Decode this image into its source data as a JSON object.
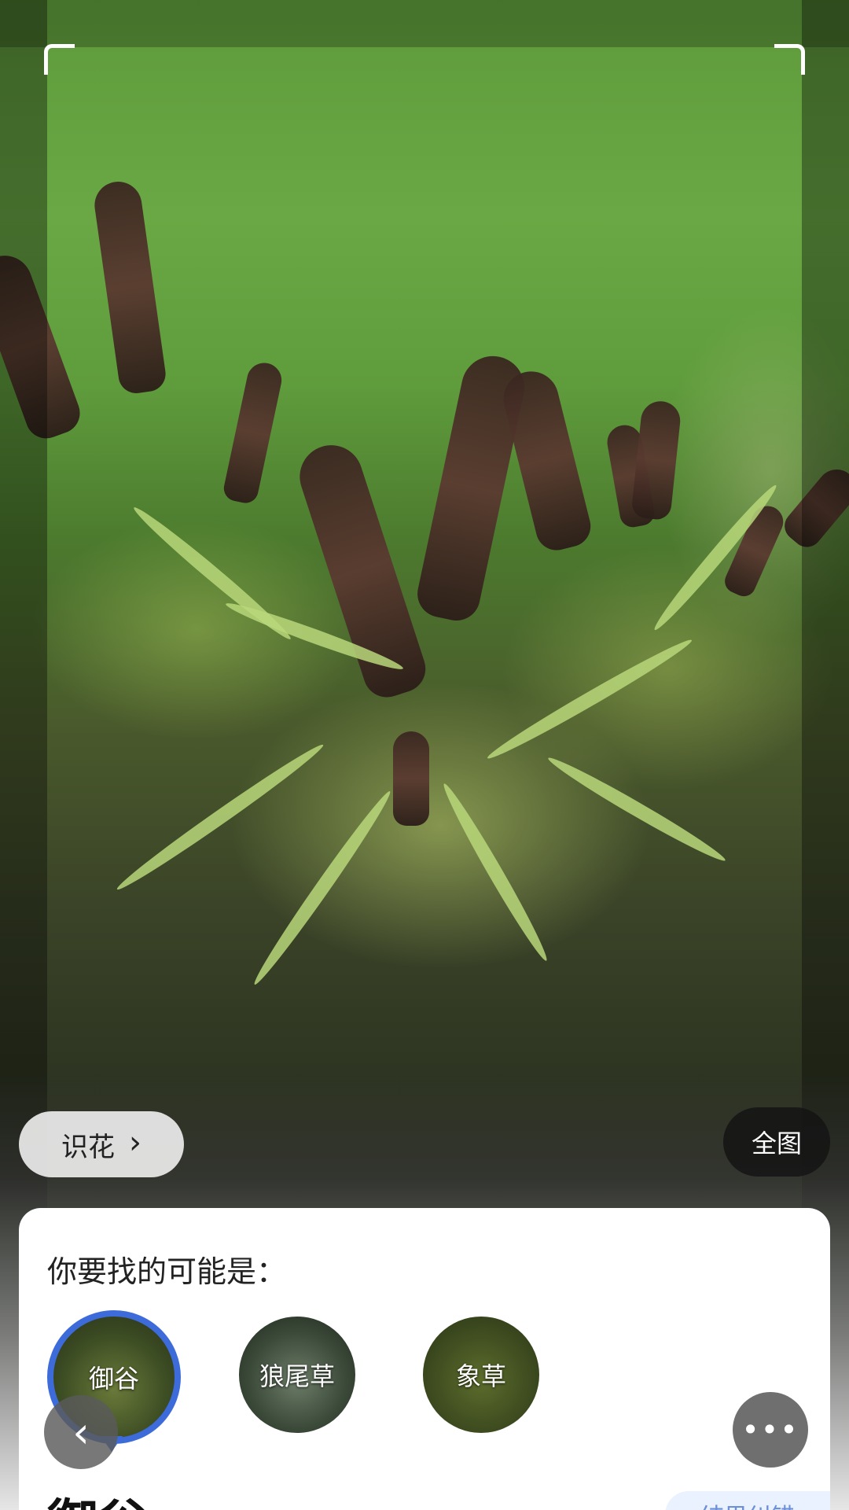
{
  "toolbar": {
    "identify_flower_label": "识花",
    "identify_flower_icon": "chevron-right-icon",
    "full_image_label": "全图"
  },
  "result_card": {
    "prompt": "你要找的可能是：",
    "candidates": [
      {
        "label": "御谷",
        "selected": true
      },
      {
        "label": "狼尾草",
        "selected": false
      },
      {
        "label": "象草",
        "selected": false
      }
    ],
    "result_title": "御谷",
    "feedback_label": "结果纠错"
  },
  "floating": {
    "back_icon": "chevron-left-icon",
    "more_icon": "more-dots-icon"
  },
  "colors": {
    "accent": "#3d6bd9",
    "card_bg": "#ffffff",
    "pill_light": "#ebebeb",
    "pill_dark": "#141414"
  }
}
